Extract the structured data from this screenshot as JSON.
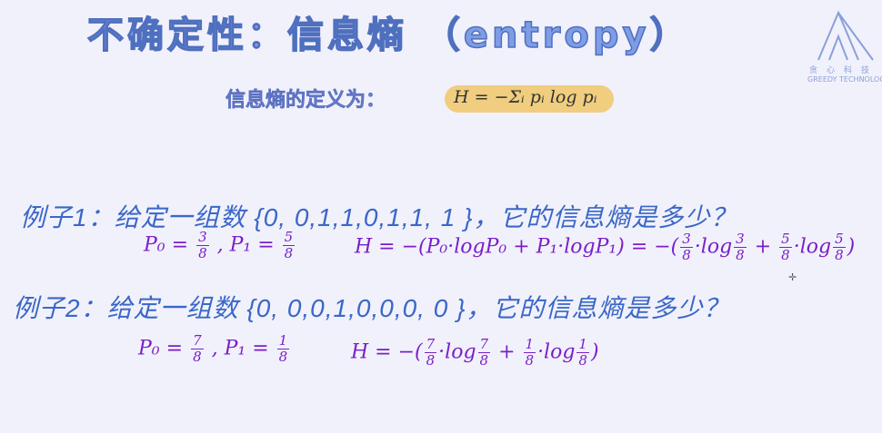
{
  "title": "不确定性：信息熵 （entropy）",
  "logo": {
    "cn": "贪心科技",
    "en": "GREEDY TECHNOLOGY"
  },
  "definition": {
    "label": "信息熵的定义为：",
    "formula": "H = −Σᵢ pᵢ log pᵢ"
  },
  "example1": {
    "text": "例子1：给定一组数 {0, 0,1,1,0,1,1, 1 }，它的信息熵是多少？",
    "p0_label": "P₀ =",
    "p0_num": "3",
    "p0_den": "8",
    "sep": ",",
    "p1_label": "P₁ =",
    "p1_num": "5",
    "p1_den": "8",
    "h_expr": "H = −(P₀·logP₀ + P₁·logP₁) = −(",
    "t1_num": "3",
    "t1_den": "8",
    "t1_log": "·log",
    "t1_lnum": "3",
    "t1_lden": "8",
    "plus": "+",
    "t2_num": "5",
    "t2_den": "8",
    "t2_log": "·log",
    "t2_lnum": "5",
    "t2_lden": "8",
    "close": ")"
  },
  "example2": {
    "text": "例子2：给定一组数 {0, 0,0,1,0,0,0, 0 }，它的信息熵是多少？",
    "p0_label": "P₀ =",
    "p0_num": "7",
    "p0_den": "8",
    "sep": ",",
    "p1_label": "P₁ =",
    "p1_num": "1",
    "p1_den": "8",
    "h_expr": "H = −(",
    "t1_num": "7",
    "t1_den": "8",
    "t1_log": "·log",
    "t1_lnum": "7",
    "t1_lden": "8",
    "plus": "+",
    "t2_num": "1",
    "t2_den": "8",
    "t2_log": "·log",
    "t2_lnum": "1",
    "t2_lden": "8",
    "close": ")"
  }
}
